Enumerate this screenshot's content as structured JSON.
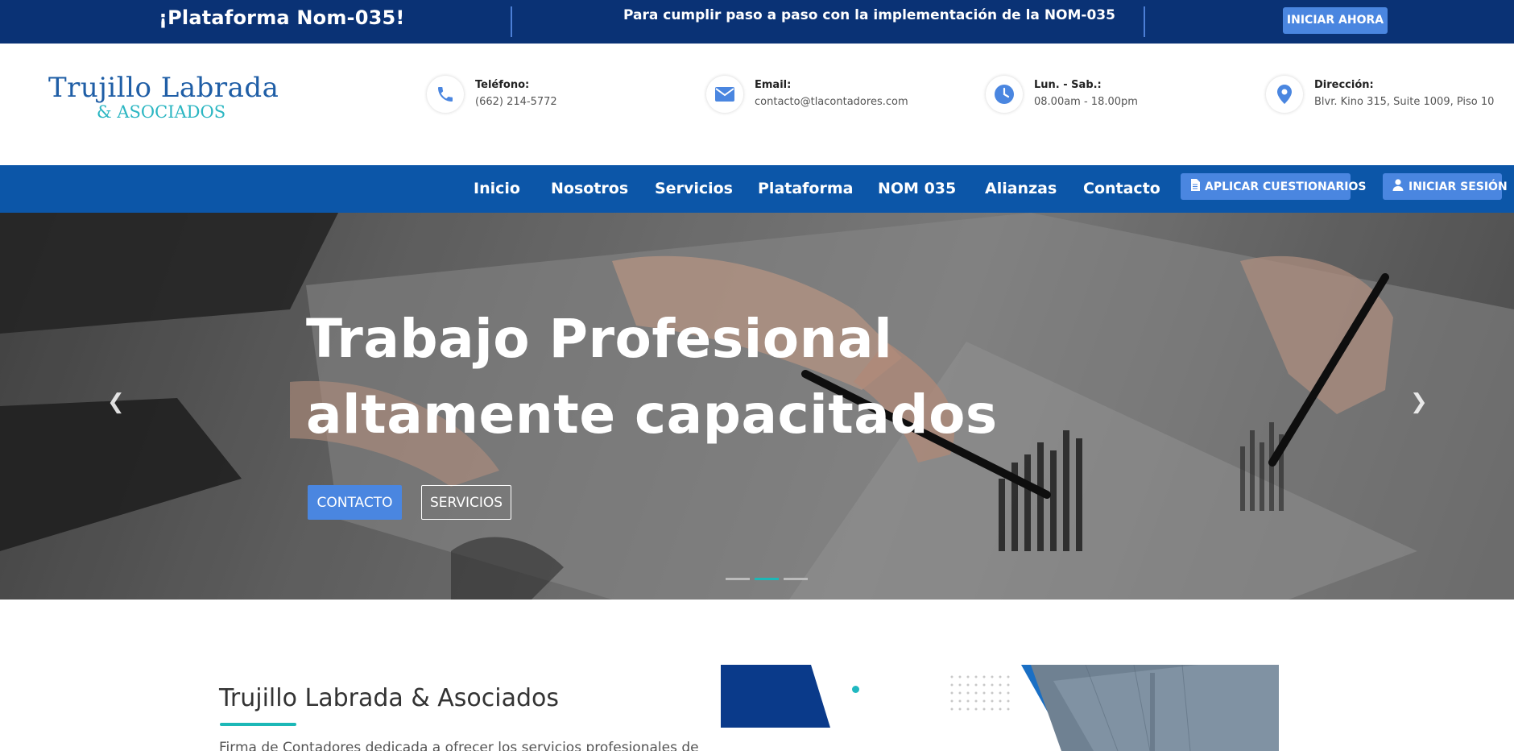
{
  "topbar": {
    "promo": "¡Plataforma Nom-035!",
    "tagline": "Para cumplir paso a paso con la implementación de la NOM-035",
    "cta": "INICIAR AHORA"
  },
  "logo": {
    "line1": "Trujillo Labrada",
    "line2": "& ASOCIADOS"
  },
  "contact_info": [
    {
      "icon": "phone-icon",
      "label": "Teléfono:",
      "value": "(662) 214-5772"
    },
    {
      "icon": "envelope-icon",
      "label": "Email:",
      "value": "contacto@tlacontadores.com"
    },
    {
      "icon": "clock-icon",
      "label": "Lun. - Sab.:",
      "value": "08.00am - 18.00pm"
    },
    {
      "icon": "map-pin-icon",
      "label": "Dirección:",
      "value": "Blvr. Kino 315, Suite 1009, Piso 10"
    }
  ],
  "nav": {
    "items": [
      "Inicio",
      "Nosotros",
      "Servicios",
      "Plataforma",
      "NOM 035",
      "Alianzas",
      "Contacto"
    ],
    "apply_button": "APLICAR CUESTIONARIOS",
    "login_button": "INICIAR SESIÓN"
  },
  "hero": {
    "title_line1": "Trabajo Profesional",
    "title_line2": "altamente capacitados",
    "contact_button": "CONTACTO",
    "services_button": "SERVICIOS",
    "slide_count": 3,
    "active_slide": 2
  },
  "about": {
    "title": "Trujillo Labrada & Asociados",
    "text": "Firma de Contadores dedicada a ofrecer los servicios profesionales de"
  },
  "colors": {
    "topbar_bg": "#0a3275",
    "nav_bg": "#0c56a8",
    "accent_button": "#4a86e0",
    "teal": "#1cb8b7",
    "logo_blue": "#1f5ea6"
  }
}
